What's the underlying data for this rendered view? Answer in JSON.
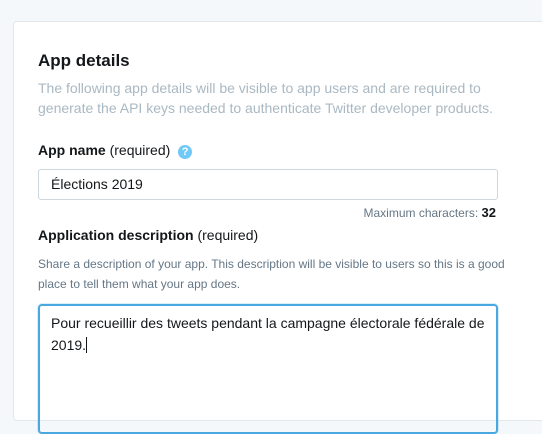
{
  "section": {
    "title": "App details",
    "description": "The following app details will be visible to app users and are required to generate the API keys needed to authenticate Twitter developer products."
  },
  "app_name": {
    "label": "App name",
    "required_text": "(required)",
    "help_icon": "question-mark-icon",
    "value": "Élections 2019",
    "max_chars_label": "Maximum characters:",
    "max_chars_value": "32"
  },
  "app_description": {
    "label": "Application description",
    "required_text": "(required)",
    "help_text": "Share a description of your app. This description will be visible to users so this is a good place to tell them what your app does.",
    "value": "Pour recueillir des tweets pendant la campagne électorale fédérale de 2019."
  },
  "colors": {
    "accent": "#1da1f2",
    "focus_border": "#4aa8e0",
    "muted_text": "#aab8c2"
  }
}
